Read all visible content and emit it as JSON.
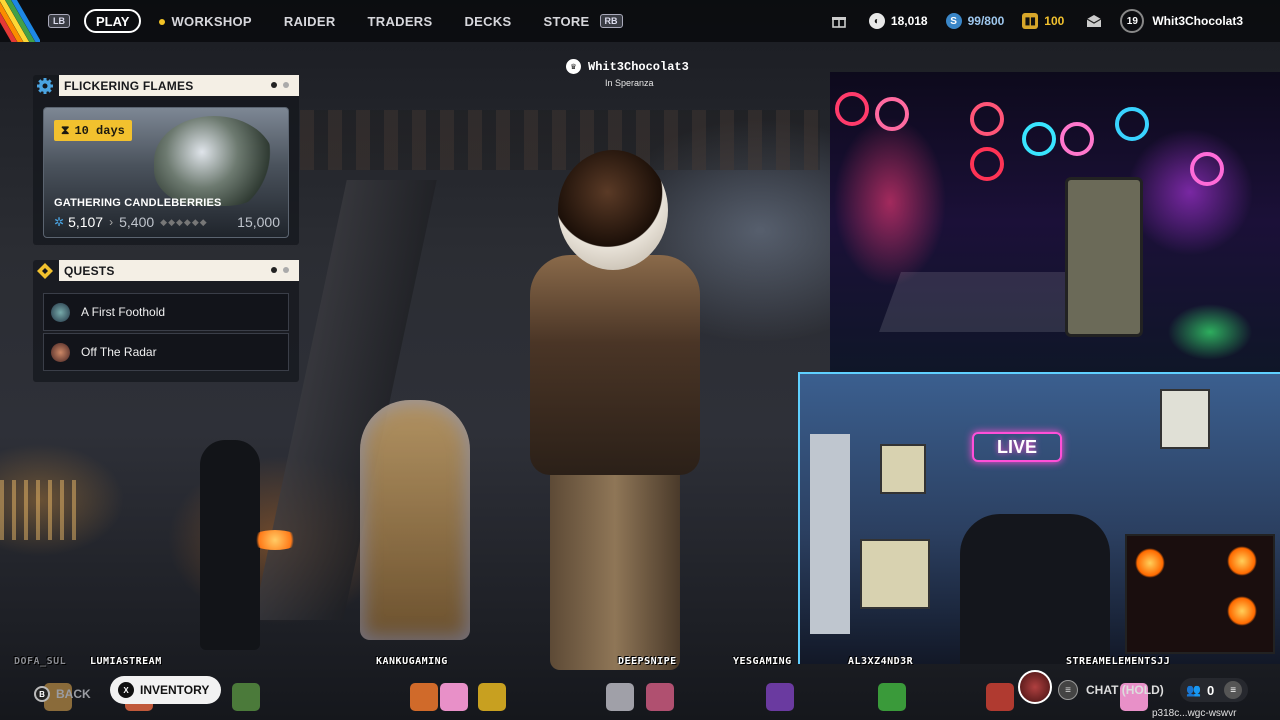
{
  "nav": {
    "lb": "LB",
    "rb": "RB",
    "items": [
      "PLAY",
      "WORKSHOP",
      "RAIDER",
      "TRADERS",
      "DECKS",
      "STORE"
    ]
  },
  "stats": {
    "coins": "18,018",
    "tokens": "99/800",
    "tickets": "100",
    "level": "19",
    "username": "Whit3Chocolat3"
  },
  "event": {
    "title": "FLICKERING FLAMES",
    "timer": "10 days",
    "name": "GATHERING CANDLEBERRIES",
    "current": "5,107",
    "next": "5,400",
    "max": "15,000"
  },
  "quests": {
    "title": "QUESTS",
    "items": [
      "A First Foothold",
      "Off The Radar"
    ]
  },
  "player": {
    "name": "Whit3Chocolat3",
    "location": "In Speranza"
  },
  "cam": {
    "live_sign": "LIVE"
  },
  "viewers": [
    "DOFA_SUL",
    "LUMIASTREAM",
    "KANKUGAMING",
    "DEEPSNIPE",
    "YESGAMING",
    "AL3XZ4ND3R",
    "STREAMELEMENTSJJ"
  ],
  "bottom": {
    "back": "BACK",
    "inventory": "INVENTORY",
    "chat": "CHAT (HOLD)",
    "party_count": "0",
    "url": "p318c...wgc-wswvr"
  },
  "colors": {
    "accent_yellow": "#f2c12e",
    "panel_header": "#f4efe5",
    "token_blue": "#3a86c8"
  }
}
